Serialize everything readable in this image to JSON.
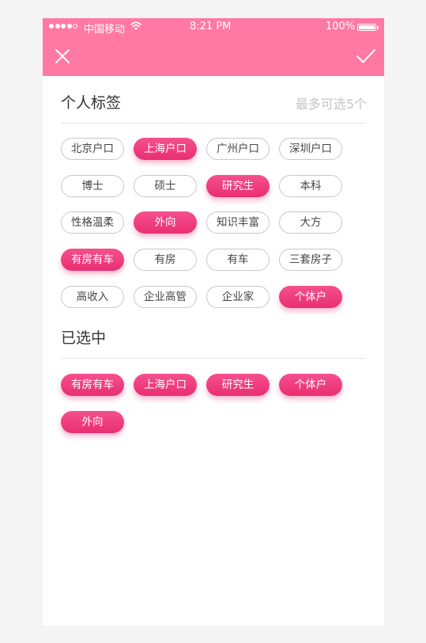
{
  "status_bar": {
    "carrier": "中国移动",
    "time": "8:21 PM",
    "battery": "100%",
    "signal_bars": 4,
    "signal_total": 5
  },
  "colors": {
    "header": "#ff79a2",
    "accent": "#e92e72",
    "hint": "#c4c4c4"
  },
  "header": {
    "close_icon": "close-icon",
    "confirm_icon": "checkmark-icon"
  },
  "personal_tags": {
    "title": "个人标签",
    "hint": "最多可选5个",
    "tags": [
      {
        "label": "北京户口",
        "selected": false
      },
      {
        "label": "上海户口",
        "selected": true
      },
      {
        "label": "广州户口",
        "selected": false
      },
      {
        "label": "深圳户口",
        "selected": false
      },
      {
        "label": "博士",
        "selected": false
      },
      {
        "label": "硕士",
        "selected": false
      },
      {
        "label": "研究生",
        "selected": true
      },
      {
        "label": "本科",
        "selected": false
      },
      {
        "label": "性格温柔",
        "selected": false
      },
      {
        "label": "外向",
        "selected": true
      },
      {
        "label": "知识丰富",
        "selected": false
      },
      {
        "label": "大方",
        "selected": false
      },
      {
        "label": "有房有车",
        "selected": true
      },
      {
        "label": "有房",
        "selected": false
      },
      {
        "label": "有车",
        "selected": false
      },
      {
        "label": "三套房子",
        "selected": false
      },
      {
        "label": "高收入",
        "selected": false
      },
      {
        "label": "企业高管",
        "selected": false
      },
      {
        "label": "企业家",
        "selected": false
      },
      {
        "label": "个体户",
        "selected": true
      }
    ]
  },
  "selected_section": {
    "title": "已选中",
    "tags": [
      "有房有车",
      "上海户口",
      "研究生",
      "个体户",
      "外向"
    ]
  }
}
